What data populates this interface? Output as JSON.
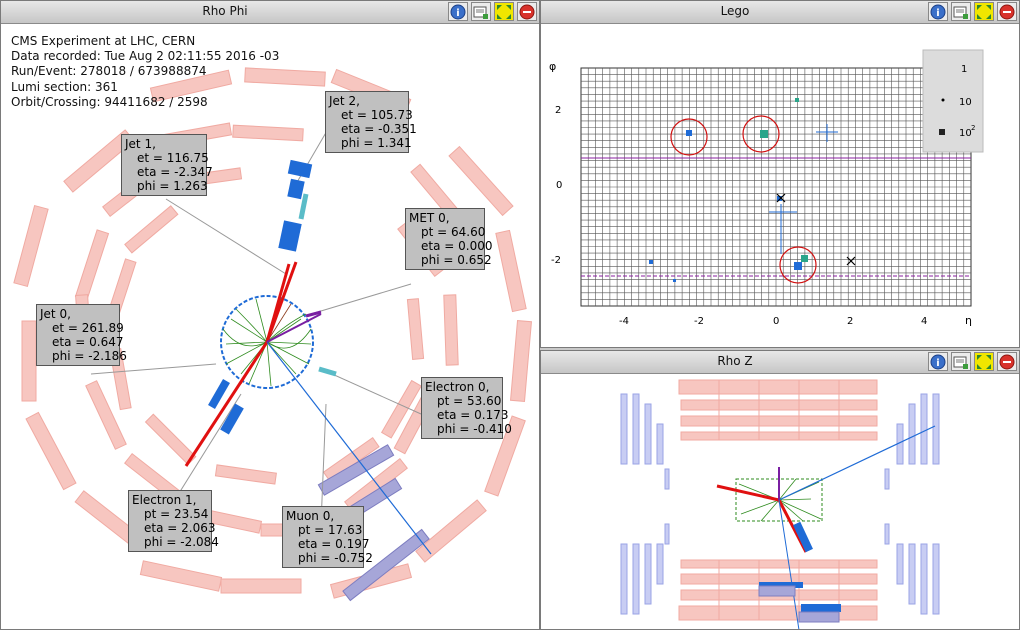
{
  "panels": {
    "rhophi": {
      "title": "Rho Phi"
    },
    "lego": {
      "title": "Lego"
    },
    "rhoz": {
      "title": "Rho Z"
    }
  },
  "event_info": {
    "line1": "CMS Experiment at LHC, CERN",
    "line2": "Data recorded: Tue Aug  2 02:11:55 2016 -03",
    "line3": "Run/Event: 278018 / 673988874",
    "line4": "Lumi section: 361",
    "line5": "Orbit/Crossing: 94411682 / 2598"
  },
  "objects": [
    {
      "name": "Jet 2,",
      "l1": "et = 105.73",
      "l2": "eta = -0.351",
      "l3": "phi = 1.341"
    },
    {
      "name": "Jet 1,",
      "l1": "et = 116.75",
      "l2": "eta = -2.347",
      "l3": "phi = 1.263"
    },
    {
      "name": "MET 0,",
      "l1": "pt = 64.60",
      "l2": "eta = 0.000",
      "l3": "phi = 0.652"
    },
    {
      "name": "Jet 0,",
      "l1": "et = 261.89",
      "l2": "eta = 0.647",
      "l3": "phi = -2.186"
    },
    {
      "name": "Electron 0,",
      "l1": "pt = 53.60",
      "l2": "eta = 0.173",
      "l3": "phi = -0.410"
    },
    {
      "name": "Electron 1,",
      "l1": "pt = 23.54",
      "l2": "eta = 2.063",
      "l3": "phi = -2.084"
    },
    {
      "name": "Muon 0,",
      "l1": "pt = 17.63",
      "l2": "eta = 0.197",
      "l3": "phi = -0.752"
    }
  ],
  "lego_axes": {
    "y_label": "φ",
    "x_label": "η",
    "y_ticks": [
      "2",
      "0",
      "-2"
    ],
    "x_ticks": [
      "-4",
      "-2",
      "0",
      "2",
      "4"
    ]
  },
  "lego_legend": {
    "l1": "1",
    "l2": "10",
    "l3": "10",
    "l3_sup": "2"
  },
  "colors": {
    "calo": "#f7c6c0",
    "muon": "#a6a6d8",
    "jet": "#1f6bd6",
    "track": "#2e8b1e",
    "electron": "#e01010",
    "met": "#7a1fa2"
  },
  "icons": [
    "info-icon",
    "snapshot-icon",
    "maximize-icon",
    "close-icon"
  ]
}
